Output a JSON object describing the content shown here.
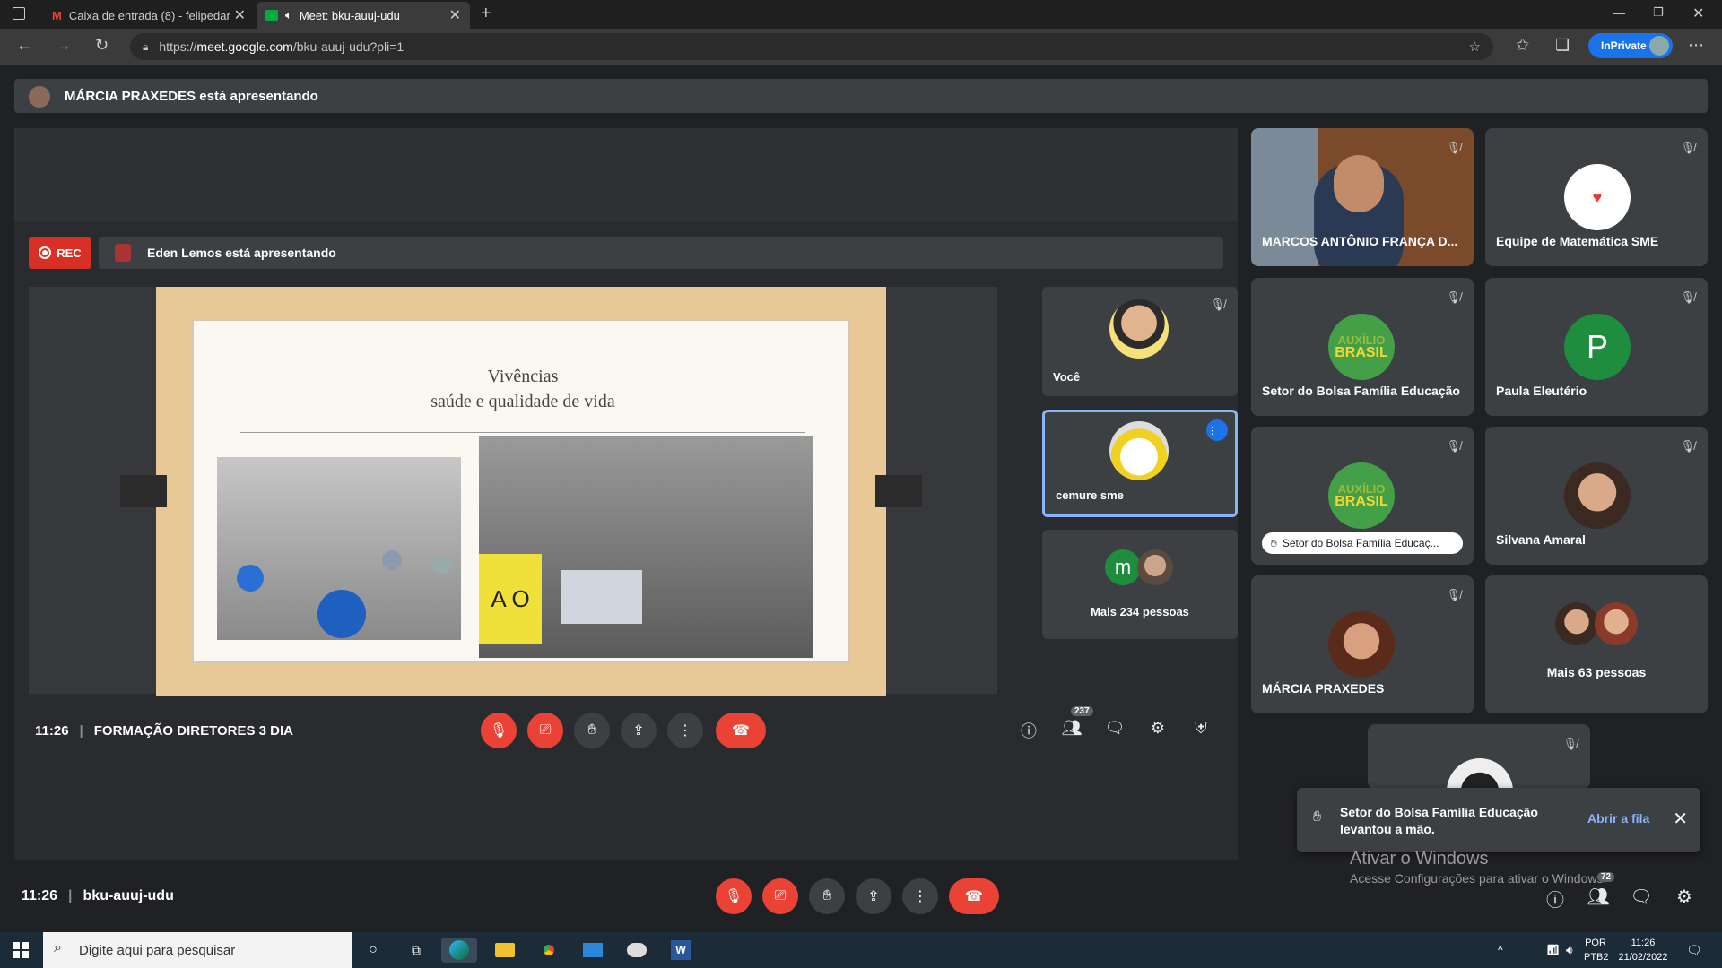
{
  "browser": {
    "tabs": [
      {
        "label": "Caixa de entrada (8) - felipedant"
      },
      {
        "label": "Meet: bku-auuj-udu"
      }
    ],
    "url_prefix": "https://",
    "url_host": "meet.google.com",
    "url_path": "/bku-auuj-udu?pli=1",
    "inprivate_label": "InPrivate"
  },
  "outer": {
    "presenter_banner": "MÁRCIA PRAXEDES está apresentando",
    "time": "11:26",
    "meeting_code": "bku-auuj-udu",
    "participants_badge": "72",
    "tiles": [
      {
        "name": "MARCOS ANTÔNIO FRANÇA D..."
      },
      {
        "name": "Equipe de Matemática SME"
      },
      {
        "name": "Setor do Bolsa Família Educação"
      },
      {
        "name": "Paula Eleutério",
        "initial": "P"
      },
      {
        "name": "Setor do Bolsa Família Educaç..."
      },
      {
        "name": "Silvana Amaral"
      },
      {
        "name": "MÁRCIA PRAXEDES"
      },
      {
        "name": "Mais 63 pessoas"
      }
    ],
    "auxilio_logo_line1": "AUXÍLIO",
    "auxilio_logo_line2": "BRASIL",
    "toast": {
      "message": "Setor do Bolsa Família Educação levantou a mão.",
      "link": "Abrir a fila"
    },
    "windows_watermark_title": "Ativar o Windows",
    "windows_watermark_sub": "Acesse Configurações para ativar o Windows."
  },
  "inner": {
    "rec_label": "REC",
    "presenter_banner": "Eden Lemos está apresentando",
    "time": "11:26",
    "meeting_title": "FORMAÇÃO DIRETORES 3 DIA",
    "participants_badge": "237",
    "slide_title_line1": "Vivências",
    "slide_title_line2": "saúde e qualidade de vida",
    "slide_photo_letters": "A O",
    "tiles": [
      {
        "name": "Você"
      },
      {
        "name": "cemure sme"
      },
      {
        "name": "Mais 234 pessoas",
        "initial": "m"
      }
    ]
  },
  "taskbar": {
    "search_placeholder": "Digite aqui para pesquisar",
    "lang1": "POR",
    "lang2": "PTB2",
    "time": "11:26",
    "date": "21/02/2022"
  },
  "colors": {
    "background": "#202124",
    "tile": "#3c4043",
    "danger": "#ea4335",
    "accent_link": "#8ab4f8",
    "active_border": "#8ab4f8"
  }
}
